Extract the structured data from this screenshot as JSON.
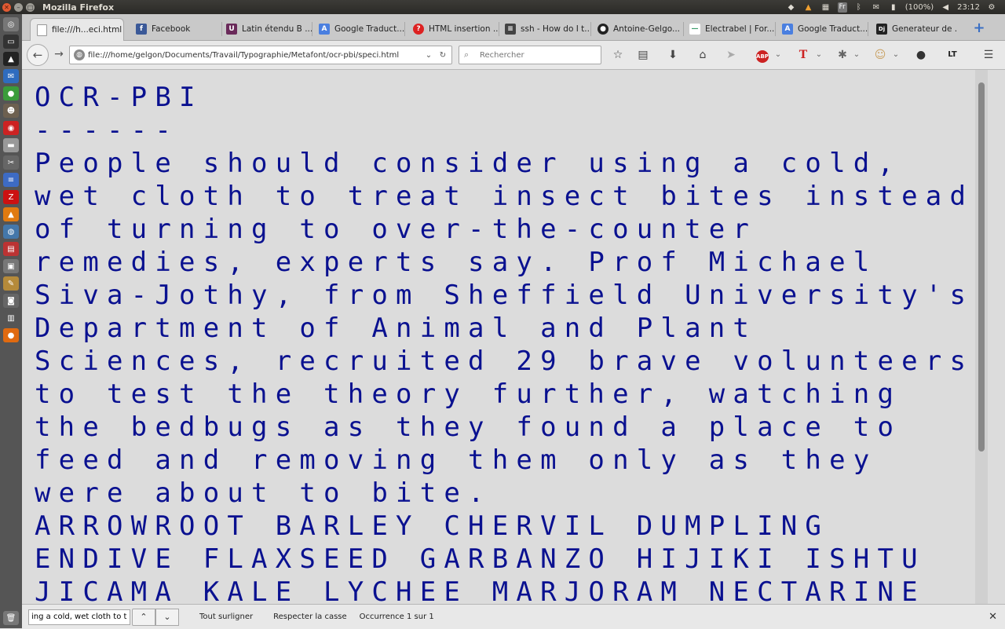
{
  "window": {
    "title": "Mozilla Firefox"
  },
  "tray": {
    "battery": "(100%)",
    "clock": "23:12",
    "keyboard": "Fr"
  },
  "tabs": [
    {
      "label": "file:///h...eci.html",
      "favicon": "page-icon"
    },
    {
      "label": "Facebook",
      "favicon": "facebook-icon"
    },
    {
      "label": "Latin étendu B ...",
      "favicon": "unicode-icon"
    },
    {
      "label": "Google Traduct...",
      "favicon": "translate-icon"
    },
    {
      "label": "HTML insertion ...",
      "favicon": "question-icon"
    },
    {
      "label": "ssh - How do I t...",
      "favicon": "stack-icon"
    },
    {
      "label": "Antoine-Gelgo...",
      "favicon": "github-icon"
    },
    {
      "label": "Electrabel | For...",
      "favicon": "electrabel-icon"
    },
    {
      "label": "Google Traduct...",
      "favicon": "translate-icon"
    },
    {
      "label": "Generateur de ...",
      "favicon": "dj-icon"
    }
  ],
  "navbar": {
    "url": "file:///home/gelgon/Documents/Travail/Typographie/Metafont/ocr-pbi/speci.html",
    "search_placeholder": "Rechercher"
  },
  "page": {
    "heading": "OCR-PBI",
    "underline": "------",
    "lines": [
      "People should consider using a cold,",
      "wet cloth to treat insect bites instead",
      "of turning to over-the-counter",
      "remedies, experts say. Prof Michael",
      "Siva-Jothy, from Sheffield University's",
      "Department of Animal and Plant",
      "Sciences, recruited 29 brave volunteers",
      "to test the theory further, watching",
      "the bedbugs as they found a place to",
      "feed and removing them only as they",
      "were about to bite.",
      "ARROWROOT BARLEY CHERVIL DUMPLING",
      "ENDIVE FLAXSEED GARBANZO HIJIKI ISHTU",
      "JICAMA KALE LYCHEE MARJORAM NECTARINE"
    ]
  },
  "findbar": {
    "query": "ing a cold, wet cloth to treat",
    "highlight_all": "Tout surligner",
    "match_case": "Respecter la casse",
    "status": "Occurrence 1 sur 1"
  }
}
